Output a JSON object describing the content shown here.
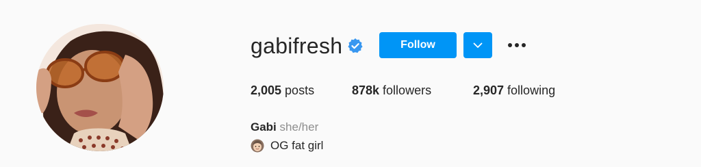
{
  "profile": {
    "username": "gabifresh",
    "verified": true,
    "avatar": "profile-photo",
    "follow_label": "Follow",
    "dropdown_icon": "chevron-down-icon",
    "more_icon": "more-options-icon"
  },
  "stats": {
    "posts_count": "2,005",
    "posts_label": " posts",
    "followers_count": "878k",
    "followers_label": " followers",
    "following_count": "2,907",
    "following_label": " following"
  },
  "bio": {
    "name": "Gabi",
    "pronouns": "she/her",
    "emoji_icon": "woman-face-emoji",
    "text": "OG fat girl"
  },
  "colors": {
    "background": "#fafafa",
    "primary_button": "#0095f6",
    "verified_badge": "#3897f0",
    "text_primary": "#262626",
    "text_secondary": "#8e8e8e"
  }
}
